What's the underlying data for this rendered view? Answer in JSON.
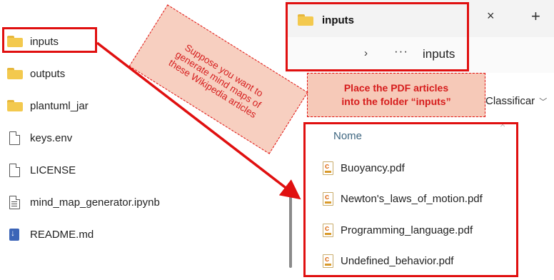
{
  "left_explorer": {
    "items": [
      {
        "label": "inputs",
        "icon": "folder-icon"
      },
      {
        "label": "outputs",
        "icon": "folder-icon"
      },
      {
        "label": "plantuml_jar",
        "icon": "folder-icon"
      },
      {
        "label": "keys.env",
        "icon": "file-icon"
      },
      {
        "label": "LICENSE",
        "icon": "file-icon"
      },
      {
        "label": "mind_map_generator.ipynb",
        "icon": "notebook-file-icon"
      },
      {
        "label": "README.md",
        "icon": "markdown-file-icon"
      }
    ]
  },
  "annotations": {
    "callout_left": "Suppose you want to generate mind maps of these Wikipedia articles",
    "callout_right_line1": "Place the PDF articles",
    "callout_right_line2": "into the folder “inputs”",
    "highlight_color": "#e01010",
    "callout_fill": "#f7cfc0"
  },
  "window": {
    "tab_title": "inputs",
    "close_glyph": "×",
    "new_tab_glyph": "+",
    "breadcrumb": {
      "chevron": "›",
      "more": "···",
      "current": "inputs"
    },
    "sort_label": "Classificar",
    "column_header": "Nome",
    "files": [
      "Buoyancy.pdf",
      "Newton's_laws_of_motion.pdf",
      "Programming_language.pdf",
      "Undefined_behavior.pdf"
    ]
  }
}
